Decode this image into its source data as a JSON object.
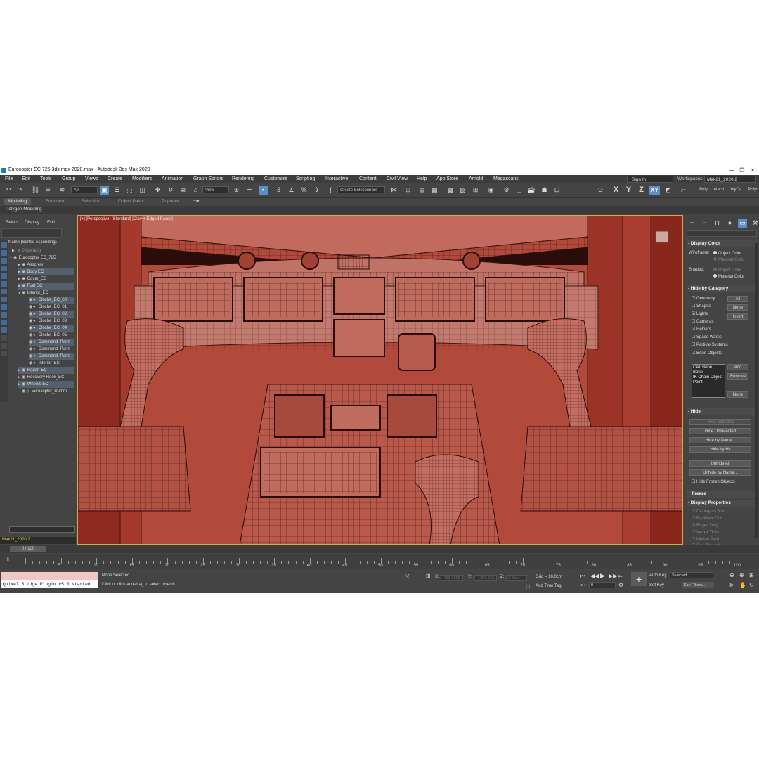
{
  "window": {
    "title": "Eurocopter EC 725 3ds max 2020.max - Autodesk 3ds Max 2020",
    "minimize": "─",
    "maximize": "❐",
    "close": "✕"
  },
  "menu": [
    "File",
    "Edit",
    "Tools",
    "Group",
    "Views",
    "Create",
    "Modifiers",
    "Animation",
    "Graph Editors",
    "Rendering",
    "Customize",
    "Scripting",
    "Interactive",
    "Content",
    "Civil View",
    "Help",
    "App Store",
    "Arnold",
    "Megascans"
  ],
  "sign_in": "Sign In",
  "workspaces_label": "Workspaces:",
  "workspaces_value": "Mak21_2020.2",
  "toolbar": {
    "filter": "All",
    "ref_coord": "View",
    "selection_set": "Create Selection Se",
    "axis_x": "X",
    "axis_y": "Y",
    "axis_z": "Z",
    "axis_xy": "XY",
    "poly": "Poly",
    "detach": "etach",
    "polyda": "'olyDa",
    "polyt": "Polyt"
  },
  "ribbon_tabs": [
    "Modeling",
    "Freeform",
    "Selection",
    "Object Paint",
    "Populate"
  ],
  "ribbon_sub": "Polygon Modeling",
  "scene_explorer": {
    "menus": [
      "Select",
      "Display",
      "Edit"
    ],
    "header": "Name (Sorted Ascending)",
    "items": [
      "0 (default)",
      "Eurocopter EC_725",
      "Airscrew",
      "Body EC",
      "Cover_EC",
      "Fuel EC",
      "Interior_EC",
      "Cloche_EC_00",
      "Cloche_EC_01",
      "Cloche_EC_02",
      "Cloche_EC_03",
      "Cloche_EC_04",
      "Cloche_EC_05",
      "Command_Pann",
      "Command_Pann",
      "Command_Pann",
      "Interior_EC",
      "Radar_EC",
      "Recovery Hook_EC",
      "Wheels EC",
      "Eurocopter_Dumm"
    ],
    "layer": "Mak21_2020.2"
  },
  "viewport": {
    "label": "[+] [Perspective] [Standard] [Clay + Edged Faces]"
  },
  "command_panel": {
    "display_color": "Display Color",
    "wireframe": "Wireframe:",
    "shaded": "Shaded:",
    "object_color": "Object Color",
    "material_color": "Material Color",
    "hide_by_category": "Hide by Category",
    "categories": [
      "Geometry",
      "Shapes",
      "Lights",
      "Cameras",
      "Helpers",
      "Space Warps",
      "Particle Systems",
      "Bone Objects"
    ],
    "cat_buttons": [
      "All",
      "None",
      "Invert"
    ],
    "list": [
      "CAT Bone",
      "Bone",
      "IK Chain Object",
      "Point"
    ],
    "list_buttons": [
      "Add",
      "Remove",
      "None"
    ],
    "hide": "Hide",
    "hide_buttons": [
      "Hide Selected",
      "Hide Unselected",
      "Hide by Name...",
      "Hide by Hit",
      "Unhide All",
      "Unhide by Name..."
    ],
    "hide_frozen": "Hide Frozen Objects",
    "freeze": "Freeze",
    "display_properties": "Display Properties",
    "display_props": [
      "Display as Box",
      "Backface Cull",
      "Edges Only",
      "Vertex Ticks",
      "Motion Path",
      "See-Through"
    ]
  },
  "timeline": {
    "frame": "0 / 100",
    "ticks": [
      "5",
      "10",
      "15",
      "20",
      "25",
      "30",
      "35",
      "40",
      "45",
      "50",
      "55",
      "60",
      "65",
      "70",
      "75",
      "80",
      "85",
      "90",
      "95",
      "100"
    ]
  },
  "status": {
    "maxscript_output": "Quixel Bridge Plugin v5.0 started",
    "selection": "None Selected",
    "prompt": "Click or click-and-drag to select objects",
    "x_label": "X:",
    "x_val": "-438.6209",
    "y_label": "Y:",
    "y_val": "-1394.633",
    "z_label": "Z:",
    "z_val": "0.0cm",
    "grid": "Grid = 10.0cm",
    "add_time_tag": "Add Time Tag",
    "auto_key": "Auto Key",
    "set_key": "Set Key",
    "selected": "Selected",
    "key_filters": "Key Filters...",
    "frame_field": "0"
  }
}
